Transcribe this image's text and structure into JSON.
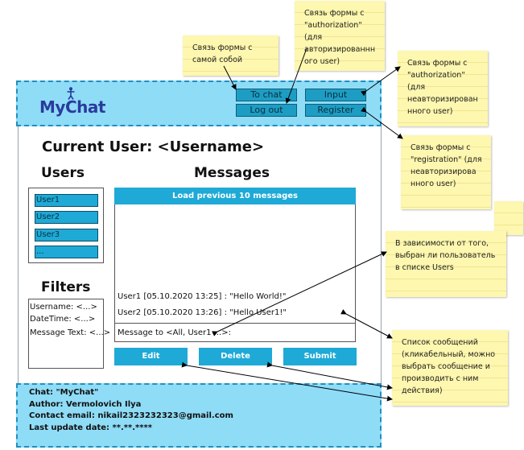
{
  "app": {
    "logo_text": "MyChat"
  },
  "header": {
    "to_chat": "To chat",
    "log_out": "Log out",
    "input": "Input",
    "register": "Register"
  },
  "main": {
    "current_user": "Current User: <Username>",
    "users_title": "Users",
    "messages_title": "Messages",
    "filters_title": "Filters",
    "users": [
      "User1",
      "User2",
      "User3",
      "..."
    ],
    "filters": [
      "Username: <...>",
      "DateTime: <...>",
      "Message Text: <...>"
    ],
    "load_previous": "Load previous 10 messages",
    "messages": [
      "User1 [05.10.2020 13:25] : \"Hello World!\"",
      "User2 [05.10.2020 13:26] : \"Hello User1!\""
    ],
    "message_input": "Message to <All, User1 ...>:",
    "edit": "Edit",
    "delete": "Delete",
    "submit": "Submit"
  },
  "footer": {
    "chat": "Chat: \"MyChat\"",
    "author": "Author: Vermolovich Ilya",
    "email": "Contact email: nikail2323232323@gmail.com",
    "last_update": "Last update date: **.**.****"
  },
  "notes": {
    "self_link": "Связь формы с самой собой",
    "auth_link_authorized": "Связь формы с \"authorization\" (для авторизированнн ого user)",
    "auth_link_unauthorized": "Связь формы с \"authorization\" (для неавторизирован нного user)",
    "registration_link": "Связь формы с \"registration\" (для неавторизирова нного user)",
    "users_dependence": "В зависимости от того, выбран ли пользователь в списке Users",
    "messages_list": "Список сообщений (кликабельный, можно выбрать сообщение и производить с ним действия)"
  },
  "colors": {
    "band": "#8fdcf7",
    "band_border": "#1f8fc0",
    "accent": "#1ea9d6",
    "note": "#fdf7b0"
  },
  "icons": [
    "person-logo-icon"
  ]
}
